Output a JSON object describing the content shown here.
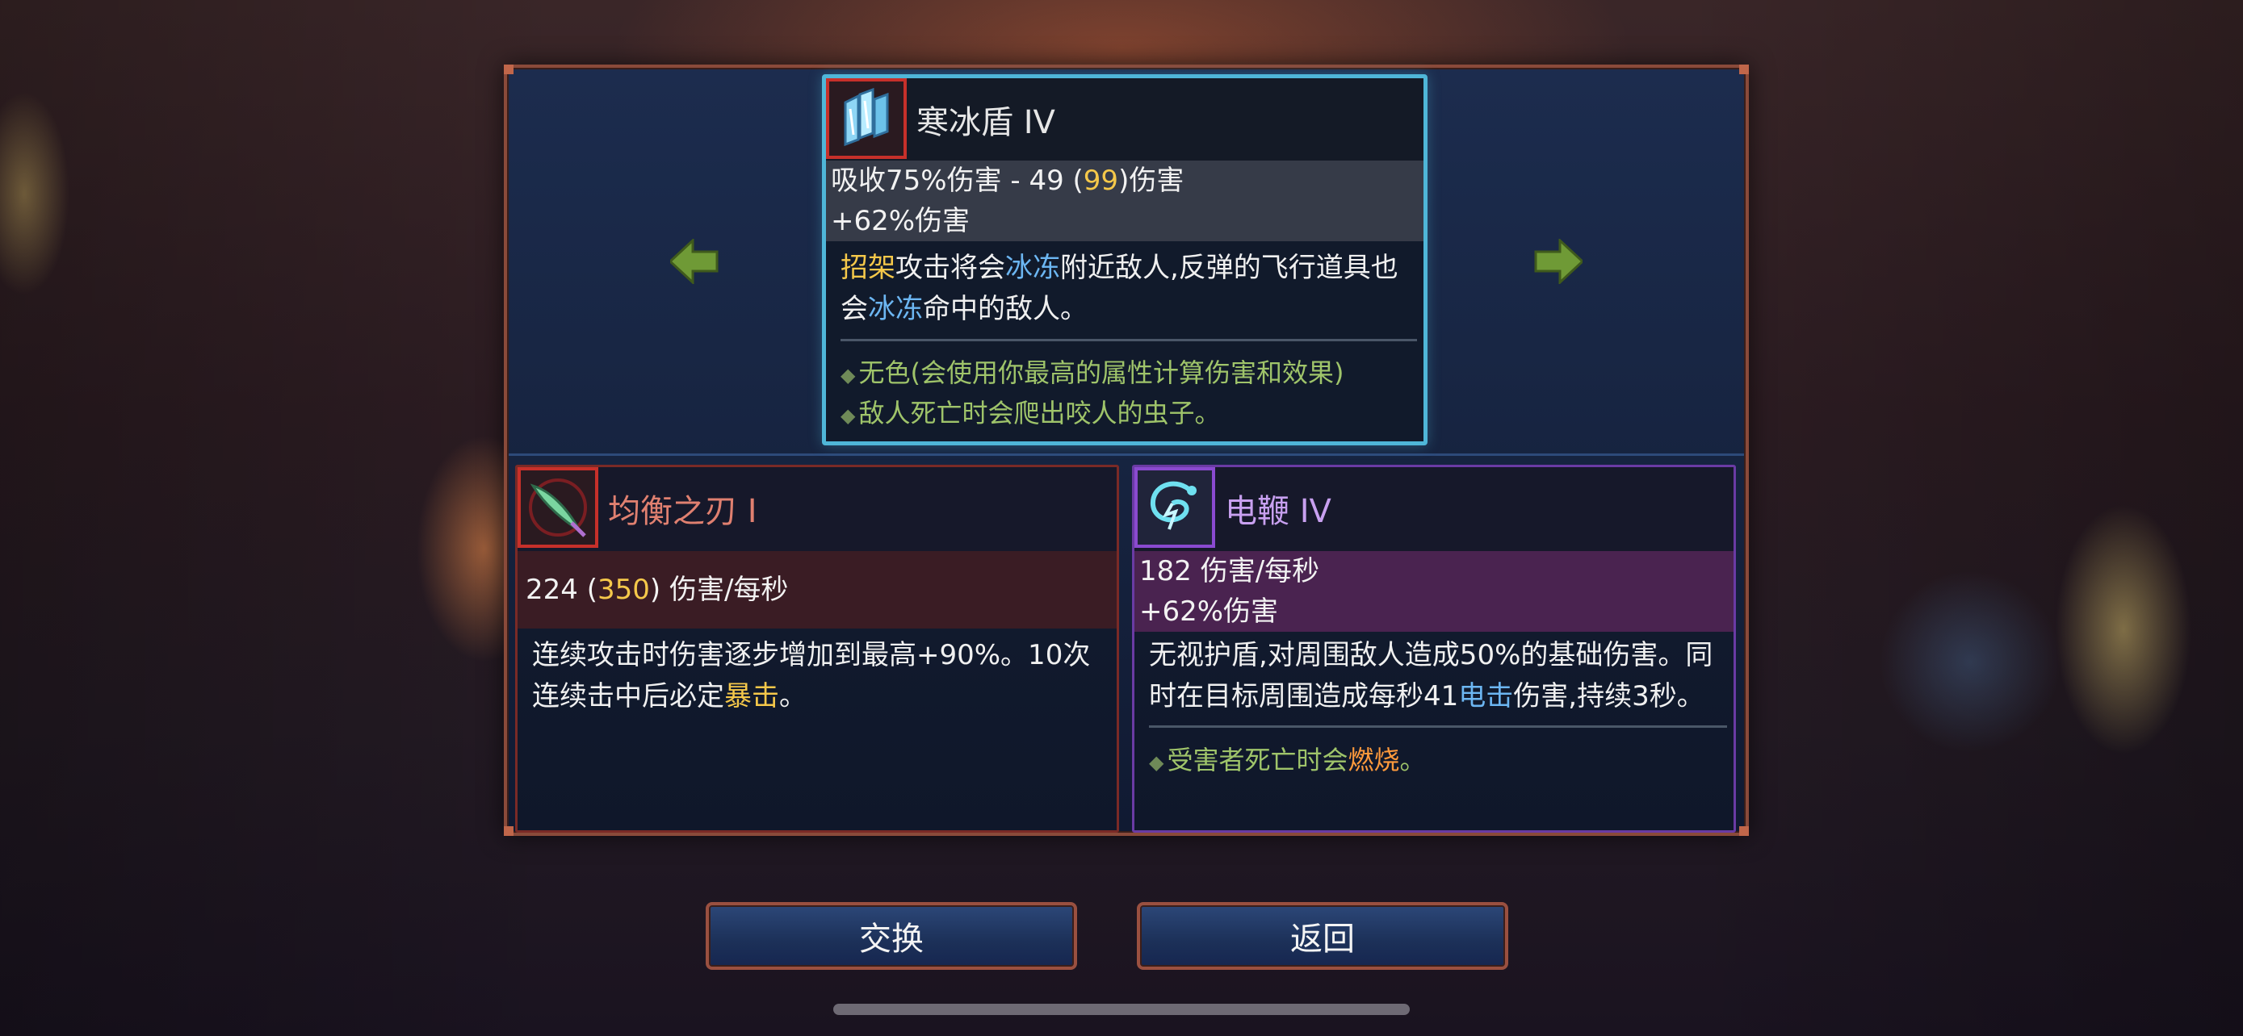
{
  "top_item": {
    "icon": "ice-shield-icon",
    "name": "寒冰盾 IV",
    "stat1_pre": "吸收75%伤害 - 49 (",
    "stat1_hl": "99",
    "stat1_post": ")伤害",
    "stat2": "+62%伤害",
    "desc": {
      "p1": "招架",
      "p2": "攻击将会",
      "p3": "冰冻",
      "p4": "附近敌人,反弹的飞行道具也会",
      "p5": "冰冻",
      "p6": "命中的敌人。"
    },
    "bullet1": "无色(会使用你最高的属性计算伤害和效果)",
    "bullet2": "敌人死亡时会爬出咬人的虫子。"
  },
  "left_item": {
    "icon": "balanced-blade-icon",
    "name": "均衡之刃 I",
    "stat_pre": "224 (",
    "stat_hl": "350",
    "stat_post": ") 伤害/每秒",
    "desc_p1": "连续攻击时伤害逐步增加到最高+90%。10次连续击中后必定",
    "desc_p2": "暴击",
    "desc_p3": "。"
  },
  "right_item": {
    "icon": "electric-whip-icon",
    "name": "电鞭 IV",
    "stat1": "182 伤害/每秒",
    "stat2": "+62%伤害",
    "desc_p1": "无视护盾,对周围敌人造成50%的基础伤害。同时在目标周围造成每秒41",
    "desc_p2": "电击",
    "desc_p3": "伤害,持续3秒。",
    "bullet_p1": "受害者死亡时会",
    "bullet_p2": "燃烧",
    "bullet_p3": "。"
  },
  "buttons": {
    "swap": "交换",
    "back": "返回"
  },
  "colors": {
    "highlight_yellow": "#f5c84a",
    "keyword_blue": "#6cb6f2",
    "keyword_orange": "#ff9a3c",
    "bullet_green": "#9fc46a",
    "top_card_border": "#4fb6d8",
    "left_card_border": "#7a2a26",
    "right_card_border": "#6a3ba4"
  }
}
